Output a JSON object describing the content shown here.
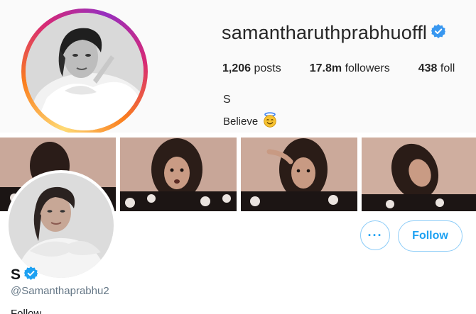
{
  "instagram": {
    "username": "samantharuthprabhuoffl",
    "stats": [
      {
        "count": "1,206",
        "label": "posts"
      },
      {
        "count": "17.8m",
        "label": "followers"
      },
      {
        "count": "438",
        "label": "foll"
      }
    ],
    "name": "S",
    "bio": "Believe",
    "bio_emoji": "😇"
  },
  "twitter": {
    "more_label": "···",
    "follow_label": "Follow",
    "display_name": "S",
    "handle": "@Samanthaprabhu2",
    "cut_text": "Follow"
  },
  "colors": {
    "verified_blue": "#3897f0",
    "twitter_blue": "#1da1f2",
    "follow_border": "#8ecdf8"
  }
}
